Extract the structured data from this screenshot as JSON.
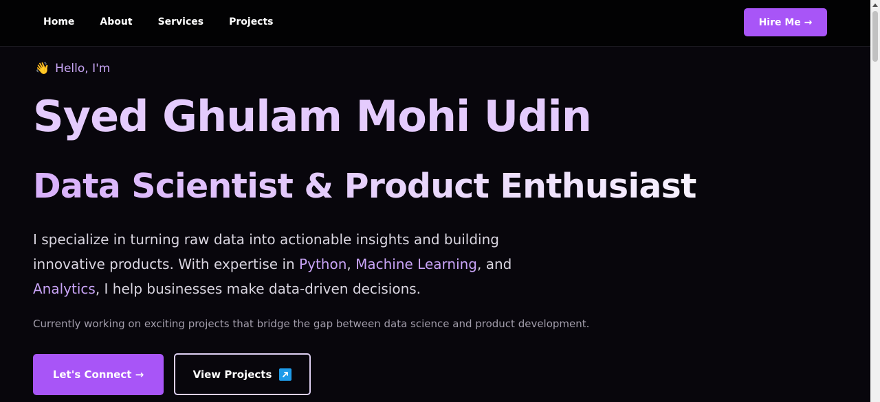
{
  "nav": {
    "links": [
      "Home",
      "About",
      "Services",
      "Projects"
    ],
    "hire_label": "Hire Me →"
  },
  "hero": {
    "greeting_icon": "👋",
    "greeting": "Hello, I'm",
    "name": "Syed Ghulam Mohi Udin",
    "role": "Data Scientist & Product Enthusiast",
    "bio": {
      "t1": "I specialize in turning raw data into actionable insights and building innovative products. With expertise in ",
      "h1": "Python",
      "t2": ", ",
      "h2": "Machine Learning",
      "t3": ", and ",
      "h3": "Analytics",
      "t4": ", I help businesses make data-driven decisions."
    },
    "sub_note": "Currently working on exciting projects that bridge the gap between data science and product development.",
    "connect_label": "Let's Connect →",
    "projects_label": "View Projects"
  },
  "colors": {
    "accent": "#a855f7",
    "background": "#08060c",
    "highlight": "#c8a3f6",
    "name": "#e4cbfd"
  },
  "icons": {
    "greeting": "waving-hand-icon",
    "projects_button": "external-link-icon"
  }
}
